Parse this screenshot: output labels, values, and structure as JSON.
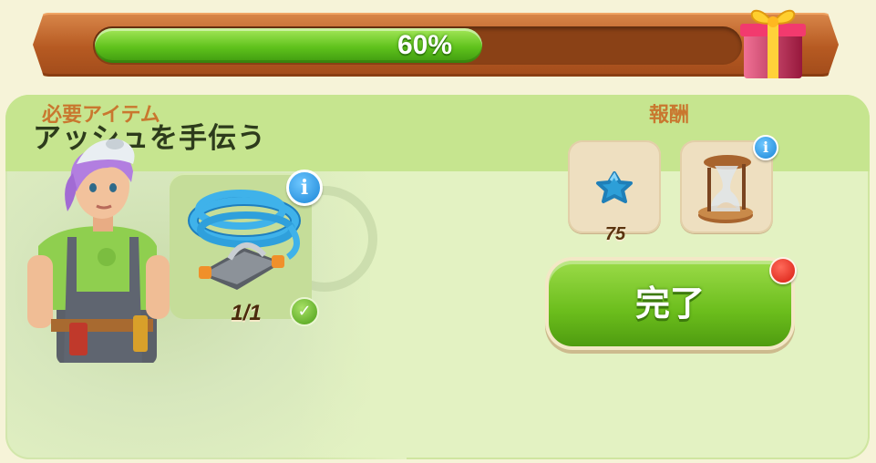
{
  "progress": {
    "value": 0.6,
    "label": "60%"
  },
  "quest": {
    "title": "アッシュを手伝う",
    "required_label": "必要アイテム",
    "reward_label": "報酬",
    "required_item": {
      "icon": "garden-hose-icon",
      "count": "1/1",
      "complete": true
    },
    "rewards": [
      {
        "icon": "blue-star-icon",
        "amount": "75"
      },
      {
        "icon": "hourglass-icon"
      }
    ],
    "complete_button": "完了"
  },
  "colors": {
    "accent_green": "#6bbd1c",
    "progress_frame": "#b65a22",
    "label_orange": "#c9772f",
    "info_blue": "#1a85d6",
    "notification_red": "#d81c10"
  }
}
